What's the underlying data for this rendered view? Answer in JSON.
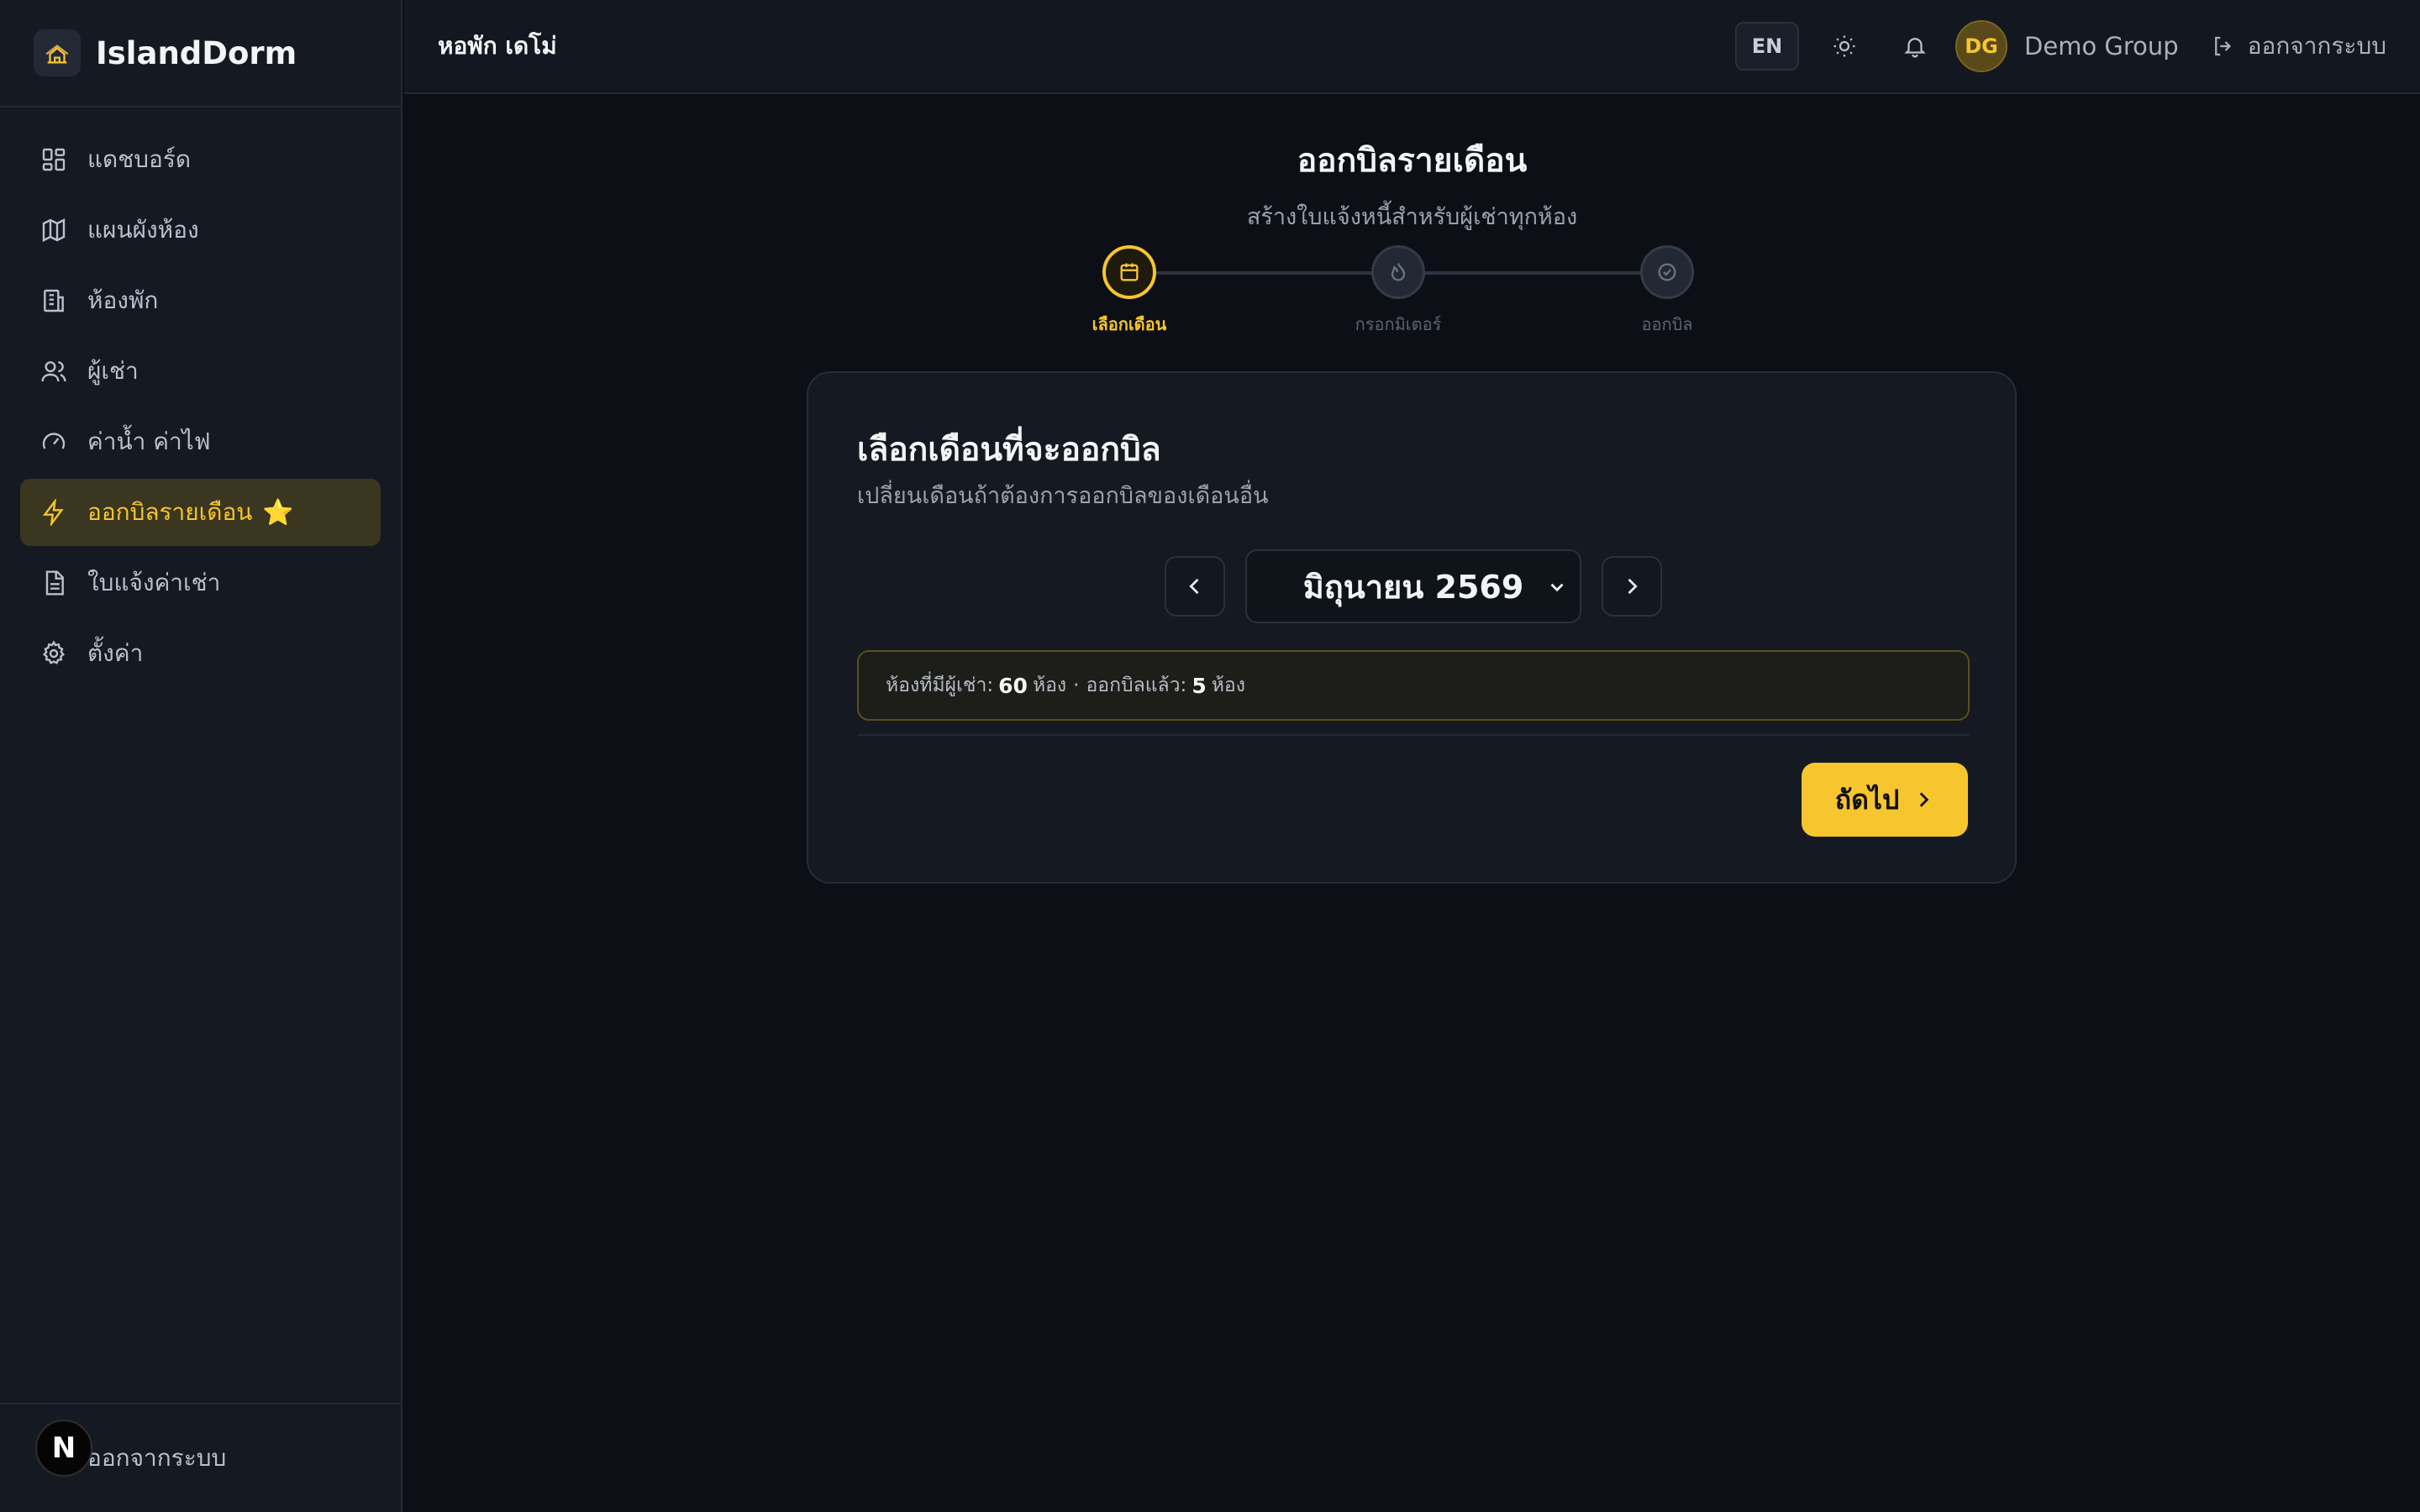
{
  "brand": {
    "name": "IslandDorm"
  },
  "sidebar": {
    "items": [
      {
        "label": "แดชบอร์ด",
        "icon": "dashboard-icon"
      },
      {
        "label": "แผนผังห้อง",
        "icon": "map-icon"
      },
      {
        "label": "ห้องพัก",
        "icon": "building-icon"
      },
      {
        "label": "ผู้เช่า",
        "icon": "users-icon"
      },
      {
        "label": "ค่าน้ำ ค่าไฟ",
        "icon": "gauge-icon"
      },
      {
        "label": "ออกบิลรายเดือน",
        "icon": "lightning-icon",
        "active": true,
        "badge": "⭐"
      },
      {
        "label": "ใบแจ้งค่าเช่า",
        "icon": "document-icon"
      },
      {
        "label": "ตั้งค่า",
        "icon": "gear-icon"
      }
    ],
    "footer_label": "ออกจากระบบ",
    "n_badge": "N"
  },
  "header": {
    "title": "หอพัก เดโม่",
    "lang": "EN",
    "avatar_initials": "DG",
    "user_name": "Demo Group",
    "logout_label": "ออกจากระบบ"
  },
  "page": {
    "title": "ออกบิลรายเดือน",
    "subtitle": "สร้างใบแจ้งหนี้สำหรับผู้เช่าทุกห้อง"
  },
  "stepper": {
    "steps": [
      {
        "label": "เลือกเดือน",
        "icon": "calendar-icon",
        "active": true
      },
      {
        "label": "กรอกมิเตอร์",
        "icon": "flame-icon",
        "active": false
      },
      {
        "label": "ออกบิล",
        "icon": "check-circle-icon",
        "active": false
      }
    ]
  },
  "card": {
    "title": "เลือกเดือนที่จะออกบิล",
    "subtitle": "เปลี่ยนเดือนถ้าต้องการออกบิลของเดือนอื่น",
    "selected_month": "มิถุนายน 2569",
    "info": {
      "occupied_label": "ห้องที่มีผู้เช่า:",
      "occupied_count": "60",
      "unit": "ห้อง",
      "separator": "·",
      "billed_label": "ออกบิลแล้ว:",
      "billed_count": "5"
    },
    "next_label": "ถัดไป"
  },
  "colors": {
    "accent": "#f7c52e",
    "background": "#0c0f15",
    "sidebar": "#151a22",
    "active_item_bg": "#3a3620"
  }
}
